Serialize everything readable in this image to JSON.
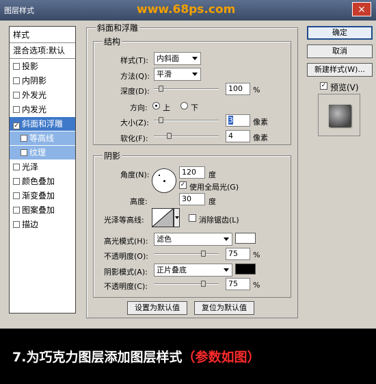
{
  "window": {
    "title": "图层样式",
    "site": "www.68ps.com",
    "close": "×"
  },
  "left_list": {
    "header": "样式",
    "blend": "混合选项:默认",
    "items": [
      "投影",
      "内阴影",
      "外发光",
      "内发光",
      "斜面和浮雕",
      "等高线",
      "纹理",
      "光泽",
      "颜色叠加",
      "渐变叠加",
      "图案叠加",
      "描边"
    ]
  },
  "bevel": {
    "group_label": "斜面和浮雕",
    "structure_label": "结构",
    "style_label": "样式(T):",
    "style_value": "内斜面",
    "method_label": "方法(Q):",
    "method_value": "平滑",
    "depth_label": "深度(D):",
    "depth_value": "100",
    "depth_unit": "%",
    "depth_level": 0.0,
    "direction_label": "方向:",
    "dir_up": "上",
    "dir_down": "下",
    "size_label": "大小(Z):",
    "size_value": "3",
    "size_unit": "像素",
    "soften_label": "软化(F):",
    "soften_value": "4",
    "soften_unit": "像素"
  },
  "shading": {
    "label": "阴影",
    "angle_label": "角度(N):",
    "angle_value": "120",
    "angle_unit": "度",
    "global_light": "使用全局光(G)",
    "altitude_label": "高度:",
    "altitude_value": "30",
    "altitude_unit": "度",
    "gloss_label": "光泽等高线:",
    "antialias": "消除锯齿(L)",
    "highlight_label": "高光模式(H):",
    "highlight_mode": "滤色",
    "highlight_color": "#ffffff",
    "hl_opacity_label": "不透明度(O):",
    "hl_opacity": "75",
    "hl_unit": "%",
    "shadow_label": "阴影模式(A):",
    "shadow_mode": "正片叠底",
    "shadow_color": "#000000",
    "sh_opacity_label": "不透明度(C):",
    "sh_opacity": "75",
    "sh_unit": "%"
  },
  "buttons": {
    "set_default": "设置为默认值",
    "reset_default": "复位为默认值",
    "ok": "确定",
    "cancel": "取消",
    "new_style": "新建样式(W)...",
    "preview": "预览(V)"
  },
  "caption": {
    "main": "7.为巧克力图层添加图层样式",
    "paren": "（参数如图）"
  }
}
